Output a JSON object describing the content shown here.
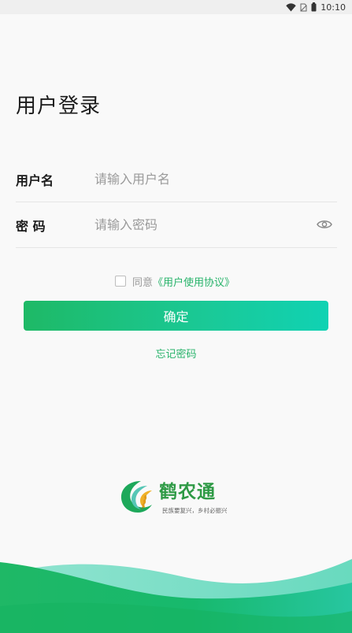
{
  "status_bar": {
    "time": "10:10",
    "icons": [
      "wifi-icon",
      "no-sim-icon",
      "battery-icon"
    ]
  },
  "login": {
    "title": "用户登录",
    "username": {
      "label": "用户名",
      "placeholder": "请输入用户名",
      "value": ""
    },
    "password": {
      "label": "密 码",
      "placeholder": "请输入密码",
      "value": "",
      "toggle_icon": "eye-icon"
    },
    "agreement": {
      "checked": false,
      "prefix": "同意",
      "link": "《用户使用协议》"
    },
    "confirm_label": "确定",
    "forgot_label": "忘记密码"
  },
  "brand": {
    "name": "鹤农通",
    "slogan": "民族要复兴，乡村必振兴"
  },
  "colors": {
    "accent": "#1eb966",
    "accent_end": "#10d2b3",
    "link": "#27b36a",
    "logo_text": "#2e9a45"
  }
}
